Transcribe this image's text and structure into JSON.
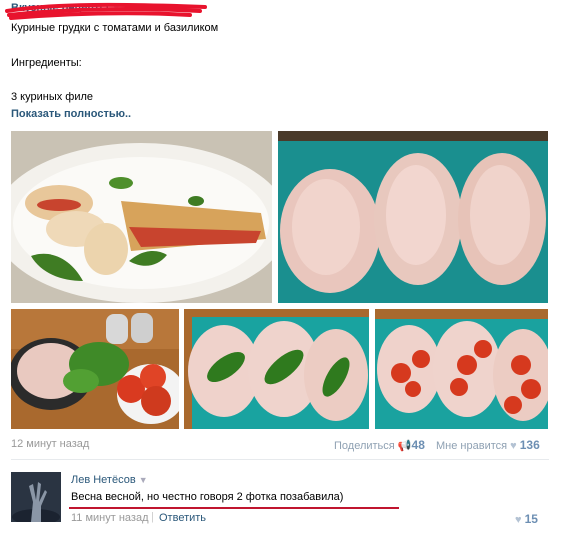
{
  "post": {
    "author": "Вкусные рецепты",
    "lines": [
      "Куриные грудки с томатами и базиликом",
      "Ингредиенты:",
      "3 куриных филе"
    ],
    "show_more": "Показать полностью..",
    "time": "12 минут назад",
    "share_label": "Поделиться",
    "share_count": "48",
    "like_label": "Мне нравится",
    "like_count": "136"
  },
  "photos": [
    "stuffed-chicken-plate",
    "raw-chicken-breasts",
    "chicken-basil-tomatoes",
    "breasts-with-basil",
    "breasts-with-tomatoes"
  ],
  "comment": {
    "author": "Лев Нетёсов",
    "text": "Весна весной, но честно говоря 2 фотка позабавила)",
    "time": "11 минут назад",
    "separator": "|",
    "reply": "Ответить",
    "like_count": "15"
  },
  "icons": {
    "dropdown": "chevron-down-icon",
    "share": "megaphone-icon",
    "like": "heart-icon"
  },
  "colors": {
    "link": "#2b587a",
    "meta": "#999999",
    "redaction": "#e8132d"
  }
}
